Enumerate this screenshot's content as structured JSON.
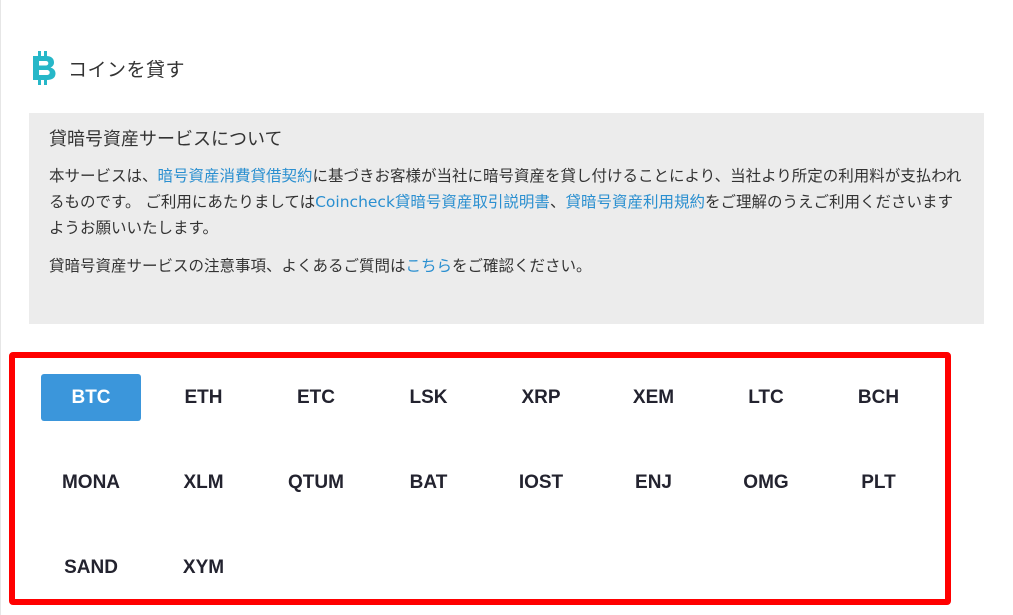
{
  "header": {
    "title": "コインを貸す",
    "icon": "bitcoin-icon",
    "icon_color": "#26b7c8"
  },
  "info": {
    "title": "貸暗号資産サービスについて",
    "p1_a": "本サービスは、",
    "p1_link1": "暗号資産消費貸借契約",
    "p1_b": "に基づきお客様が当社に暗号資産を貸し付けることにより、当社より所定の利用料が支払われるものです。 ご利用にあたりましては",
    "p1_link2": "Coincheck貸暗号資産取引説明書",
    "p1_c": "、",
    "p1_link3": "貸暗号資産利用規約",
    "p1_d": "をご理解のうえご利用くださいますようお願いいたします。",
    "p2_a": "貸暗号資産サービスの注意事項、よくあるご質問は",
    "p2_link": "こちら",
    "p2_b": "をご確認ください。"
  },
  "coins": {
    "selected": "BTC",
    "items": [
      "BTC",
      "ETH",
      "ETC",
      "LSK",
      "XRP",
      "XEM",
      "LTC",
      "BCH",
      "MONA",
      "XLM",
      "QTUM",
      "BAT",
      "IOST",
      "ENJ",
      "OMG",
      "PLT",
      "SAND",
      "XYM"
    ]
  },
  "colors": {
    "accent": "#3b96db",
    "link": "#2a8fd0",
    "highlight_border": "#ff0000",
    "info_bg": "#ececec"
  }
}
